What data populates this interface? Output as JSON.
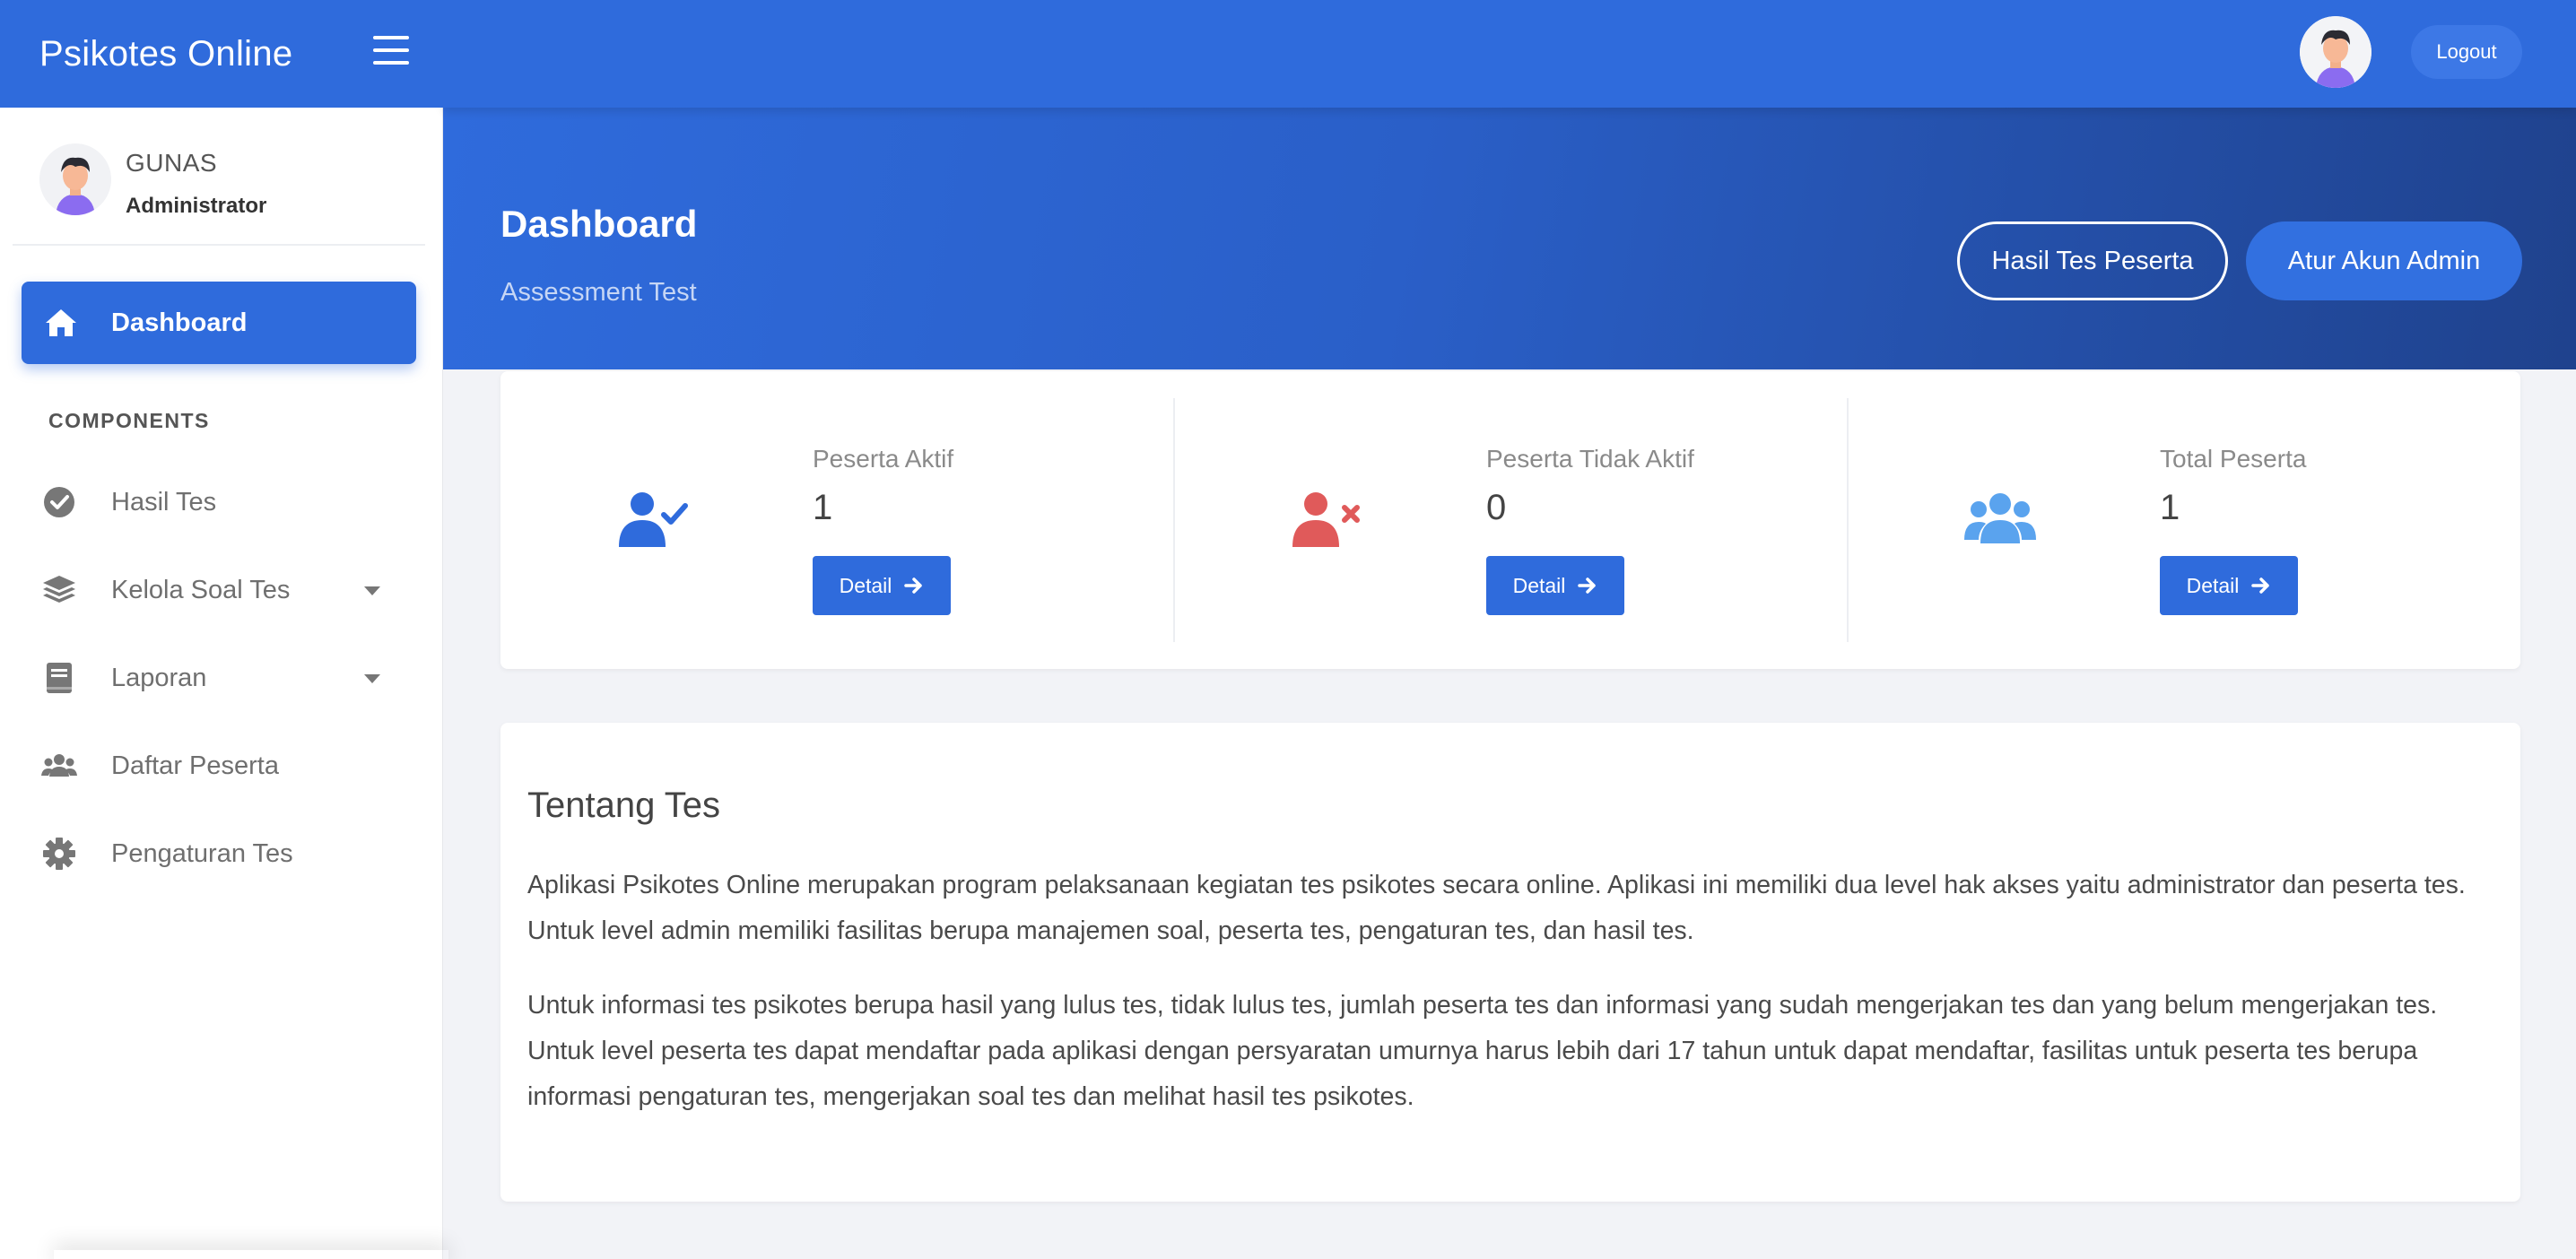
{
  "app": {
    "brand": "Psikotes Online"
  },
  "header": {
    "logout_label": "Logout"
  },
  "user": {
    "name": "GUNAS",
    "role": "Administrator"
  },
  "sidebar": {
    "active": {
      "label": "Dashboard",
      "icon": "home-icon"
    },
    "section_label": "COMPONENTS",
    "items": [
      {
        "label": "Hasil Tes",
        "icon": "check-circle-icon",
        "has_caret": false
      },
      {
        "label": "Kelola Soal Tes",
        "icon": "layers-icon",
        "has_caret": true
      },
      {
        "label": "Laporan",
        "icon": "book-icon",
        "has_caret": true
      },
      {
        "label": "Daftar Peserta",
        "icon": "users-icon",
        "has_caret": false
      },
      {
        "label": "Pengaturan Tes",
        "icon": "gear-icon",
        "has_caret": false
      }
    ]
  },
  "hero": {
    "title": "Dashboard",
    "subtitle": "Assessment Test",
    "btn_hasil": "Hasil Tes Peserta",
    "btn_atur": "Atur Akun Admin"
  },
  "stats": [
    {
      "label": "Peserta Aktif",
      "value": "1",
      "button": "Detail",
      "icon": "user-check-icon",
      "color": "#2f6bdc"
    },
    {
      "label": "Peserta Tidak Aktif",
      "value": "0",
      "button": "Detail",
      "icon": "user-times-icon",
      "color": "#e05a5a"
    },
    {
      "label": "Total Peserta",
      "value": "1",
      "button": "Detail",
      "icon": "users-icon",
      "color": "#5aa3ee"
    }
  ],
  "about": {
    "title": "Tentang Tes",
    "p1": "Aplikasi Psikotes Online merupakan program pelaksanaan kegiatan tes psikotes secara online. Aplikasi ini memiliki dua level hak akses yaitu administrator dan peserta tes. Untuk level admin memiliki fasilitas berupa manajemen soal, peserta tes, pengaturan tes, dan hasil tes.",
    "p2": "Untuk informasi tes psikotes berupa hasil yang lulus tes, tidak lulus tes, jumlah peserta tes dan informasi yang sudah mengerjakan tes dan yang belum mengerjakan tes. Untuk level peserta tes dapat mendaftar pada aplikasi dengan persyaratan umurnya harus lebih dari 17 tahun untuk dapat mendaftar, fasilitas untuk peserta tes berupa informasi pengaturan tes, mengerjakan soal tes dan melihat hasil tes psikotes."
  },
  "colors": {
    "primary": "#2f6bdc",
    "danger": "#e05a5a",
    "info": "#5aa3ee"
  }
}
